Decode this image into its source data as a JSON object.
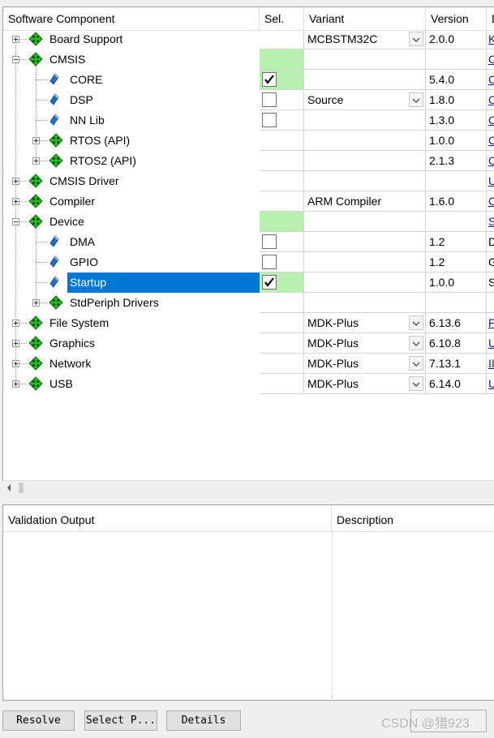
{
  "columns": {
    "component": "Software Component",
    "sel": "Sel.",
    "variant": "Variant",
    "version": "Version",
    "desc": "D"
  },
  "rows": [
    {
      "label": "Board Support",
      "level": 0,
      "expander": "plus",
      "icon": "package-icon",
      "sel": "",
      "variant": "MCBSTM32C",
      "dropdown": true,
      "version": "2.0.0",
      "desc": "K",
      "link": true
    },
    {
      "label": "CMSIS",
      "level": 0,
      "expander": "minus",
      "icon": "package-icon",
      "sel": "green",
      "variant": "",
      "dropdown": false,
      "version": "",
      "desc": "C",
      "link": true
    },
    {
      "label": "CORE",
      "level": 1,
      "expander": "",
      "icon": "component-icon",
      "sel": "checked-green",
      "variant": "",
      "dropdown": false,
      "version": "5.4.0",
      "desc": "C",
      "link": true
    },
    {
      "label": "DSP",
      "level": 1,
      "expander": "",
      "icon": "component-icon",
      "sel": "unchecked",
      "variant": "Source",
      "dropdown": true,
      "version": "1.8.0",
      "desc": "C",
      "link": true
    },
    {
      "label": "NN Lib",
      "level": 1,
      "expander": "",
      "icon": "component-icon",
      "sel": "unchecked",
      "variant": "",
      "dropdown": false,
      "version": "1.3.0",
      "desc": "C",
      "link": true
    },
    {
      "label": "RTOS (API)",
      "level": 1,
      "expander": "plus",
      "icon": "package-icon",
      "sel": "",
      "variant": "",
      "dropdown": false,
      "version": "1.0.0",
      "desc": "C",
      "link": true
    },
    {
      "label": "RTOS2 (API)",
      "level": 1,
      "expander": "plus",
      "icon": "package-icon",
      "sel": "",
      "variant": "",
      "dropdown": false,
      "version": "2.1.3",
      "desc": "C",
      "link": true
    },
    {
      "label": "CMSIS Driver",
      "level": 0,
      "expander": "plus",
      "icon": "package-icon",
      "sel": "",
      "variant": "",
      "dropdown": false,
      "version": "",
      "desc": "U",
      "link": true
    },
    {
      "label": "Compiler",
      "level": 0,
      "expander": "plus",
      "icon": "package-icon",
      "sel": "",
      "variant": "ARM Compiler",
      "dropdown": false,
      "version": "1.6.0",
      "desc": "C",
      "link": true
    },
    {
      "label": "Device",
      "level": 0,
      "expander": "minus",
      "icon": "package-icon",
      "sel": "green",
      "variant": "",
      "dropdown": false,
      "version": "",
      "desc": "S",
      "link": true
    },
    {
      "label": "DMA",
      "level": 1,
      "expander": "",
      "icon": "component-icon",
      "sel": "unchecked",
      "variant": "",
      "dropdown": false,
      "version": "1.2",
      "desc": "D",
      "link": false
    },
    {
      "label": "GPIO",
      "level": 1,
      "expander": "",
      "icon": "component-icon",
      "sel": "unchecked",
      "variant": "",
      "dropdown": false,
      "version": "1.2",
      "desc": "G",
      "link": false
    },
    {
      "label": "Startup",
      "level": 1,
      "expander": "",
      "icon": "component-icon",
      "sel": "checked-green",
      "variant": "",
      "dropdown": false,
      "version": "1.0.0",
      "desc": "S",
      "link": false,
      "selected": true
    },
    {
      "label": "StdPeriph Drivers",
      "level": 1,
      "expander": "plus",
      "icon": "package-icon",
      "sel": "",
      "variant": "",
      "dropdown": false,
      "version": "",
      "desc": "",
      "link": false
    },
    {
      "label": "File System",
      "level": 0,
      "expander": "plus",
      "icon": "package-icon",
      "sel": "",
      "variant": "MDK-Plus",
      "dropdown": true,
      "version": "6.13.6",
      "desc": "F",
      "link": true
    },
    {
      "label": "Graphics",
      "level": 0,
      "expander": "plus",
      "icon": "package-icon",
      "sel": "",
      "variant": "MDK-Plus",
      "dropdown": true,
      "version": "6.10.8",
      "desc": "U",
      "link": true
    },
    {
      "label": "Network",
      "level": 0,
      "expander": "plus",
      "icon": "package-icon",
      "sel": "",
      "variant": "MDK-Plus",
      "dropdown": true,
      "version": "7.13.1",
      "desc": "II",
      "link": true
    },
    {
      "label": "USB",
      "level": 0,
      "expander": "plus",
      "icon": "package-icon",
      "sel": "",
      "variant": "MDK-Plus",
      "dropdown": true,
      "version": "6.14.0",
      "desc": "U",
      "link": true
    }
  ],
  "validation": {
    "output_header": "Validation Output",
    "description_header": "Description"
  },
  "buttons": {
    "resolve": "Resolve",
    "select_packs": "Select P...",
    "details": "Details"
  },
  "watermark": "CSDN @猎923",
  "colors": {
    "selection": "#0078d7",
    "selected_green": "#b8f0b0",
    "package_icon": "#22c022",
    "component_icon": "#1e6fd0",
    "link": "#1010c0"
  }
}
